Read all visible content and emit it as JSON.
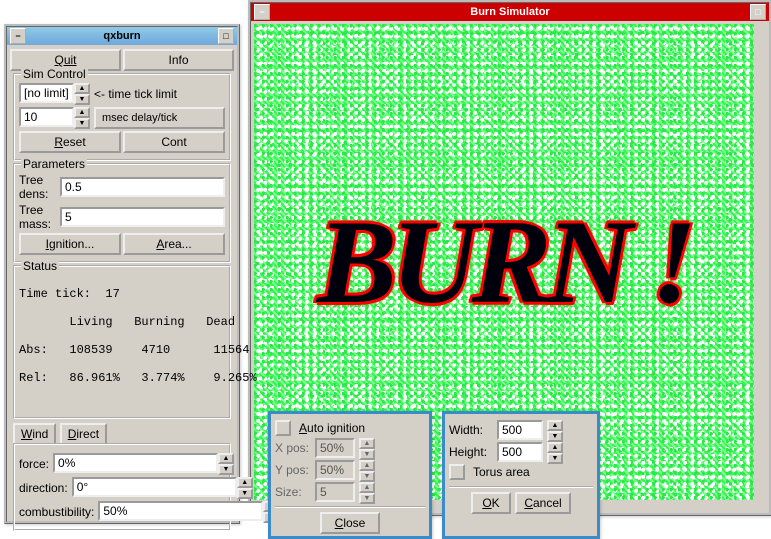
{
  "simWindow": {
    "title": "Burn Simulator",
    "canvasText": "BURN !"
  },
  "control": {
    "title": "qxburn",
    "quit": "Quit",
    "info": "Info",
    "simControlLabel": "Sim Control",
    "timeLimitValue": "[no limit]",
    "timeLimitHint": "<-  time tick limit",
    "delayValue": "10",
    "delayHint": "msec delay/tick",
    "reset": "Reset",
    "cont": "Cont",
    "paramsLabel": "Parameters",
    "treeDensLabel": "Tree dens:",
    "treeDensVal": "0.5",
    "treeMassLabel": "Tree mass:",
    "treeMassVal": "5",
    "ignition": "Ignition...",
    "area": "Area...",
    "statusLabel": "Status",
    "timeTickLine": "Time tick:  17",
    "statHeaders": "       Living   Burning   Dead",
    "statAbs": "Abs:   108539    4710      11564",
    "statRel": "Rel:   86.961%   3.774%    9.265%",
    "tabWind": "Wind",
    "tabDirect": "Direct",
    "forceLabel": "force:",
    "forceVal": "0%",
    "dirLabel": "direction:",
    "dirVal": "0°",
    "combLabel": "combustibility:",
    "combVal": "50%"
  },
  "ignDlg": {
    "autoLabel": "Auto ignition",
    "xposLabel": "X pos:",
    "xposVal": "50%",
    "yposLabel": "Y pos:",
    "yposVal": "50%",
    "sizeLabel": "Size:",
    "sizeVal": "5",
    "close": "Close"
  },
  "areaDlg": {
    "widthLabel": "Width:",
    "widthVal": "500",
    "heightLabel": "Height:",
    "heightVal": "500",
    "torusLabel": "Torus area",
    "ok": "OK",
    "cancel": "Cancel"
  }
}
